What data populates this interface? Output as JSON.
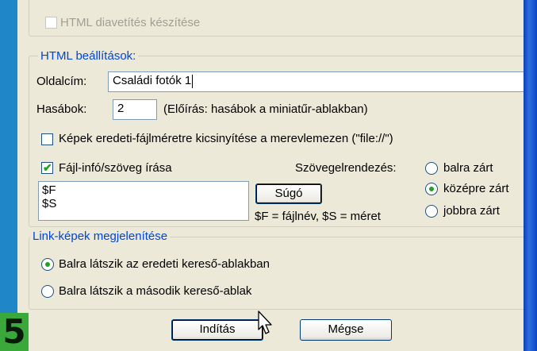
{
  "top_group": {
    "slideshow_label": "HTML diavetítés készítése",
    "slideshow_checked": false
  },
  "html_settings": {
    "legend": "HTML beállítások:",
    "title_label": "Oldalcím:",
    "title_value": "Családi fotók 1",
    "columns_label": "Hasábok:",
    "columns_value": "2",
    "columns_hint": "(Előírás: hasábok a miniatűr-ablakban)",
    "resize_label": "Képek eredeti-fájlméretre kicsinyítése a merevlemezen (\"file://\")",
    "resize_checked": false,
    "fileinfo_label": "Fájl-infó/szöveg írása",
    "fileinfo_checked": true,
    "fileinfo_lines": [
      "$F",
      "$S"
    ],
    "help_button": "Súgó",
    "help_hint": "$F = fájlnév, $S = méret",
    "alignment_label": "Szövegelrendezés:",
    "alignment_options": [
      {
        "label": "balra zárt",
        "selected": false
      },
      {
        "label": "középre zárt",
        "selected": true
      },
      {
        "label": "jobbra zárt",
        "selected": false
      }
    ]
  },
  "link_images": {
    "legend": "Link-képek megjelenítése",
    "options": [
      {
        "label": "Balra látszik az eredeti kereső-ablakban",
        "selected": true
      },
      {
        "label": "Balra látszik a második kereső-ablak",
        "selected": false
      }
    ]
  },
  "footer": {
    "start_button": "Indítás",
    "cancel_button": "Mégse",
    "step_number": "5"
  },
  "colors": {
    "accent_legend": "#0046d5",
    "window_bg": "#ece9d8",
    "outer_bg": "#1f86c8",
    "step_badge": "#3aa83a"
  }
}
